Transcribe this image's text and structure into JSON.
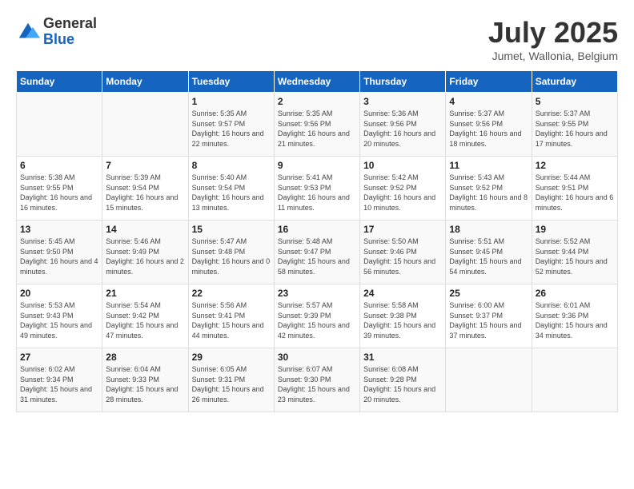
{
  "header": {
    "logo_general": "General",
    "logo_blue": "Blue",
    "month_year": "July 2025",
    "location": "Jumet, Wallonia, Belgium"
  },
  "days_of_week": [
    "Sunday",
    "Monday",
    "Tuesday",
    "Wednesday",
    "Thursday",
    "Friday",
    "Saturday"
  ],
  "weeks": [
    [
      {
        "day": "",
        "sunrise": "",
        "sunset": "",
        "daylight": ""
      },
      {
        "day": "",
        "sunrise": "",
        "sunset": "",
        "daylight": ""
      },
      {
        "day": "1",
        "sunrise": "Sunrise: 5:35 AM",
        "sunset": "Sunset: 9:57 PM",
        "daylight": "Daylight: 16 hours and 22 minutes."
      },
      {
        "day": "2",
        "sunrise": "Sunrise: 5:35 AM",
        "sunset": "Sunset: 9:56 PM",
        "daylight": "Daylight: 16 hours and 21 minutes."
      },
      {
        "day": "3",
        "sunrise": "Sunrise: 5:36 AM",
        "sunset": "Sunset: 9:56 PM",
        "daylight": "Daylight: 16 hours and 20 minutes."
      },
      {
        "day": "4",
        "sunrise": "Sunrise: 5:37 AM",
        "sunset": "Sunset: 9:56 PM",
        "daylight": "Daylight: 16 hours and 18 minutes."
      },
      {
        "day": "5",
        "sunrise": "Sunrise: 5:37 AM",
        "sunset": "Sunset: 9:55 PM",
        "daylight": "Daylight: 16 hours and 17 minutes."
      }
    ],
    [
      {
        "day": "6",
        "sunrise": "Sunrise: 5:38 AM",
        "sunset": "Sunset: 9:55 PM",
        "daylight": "Daylight: 16 hours and 16 minutes."
      },
      {
        "day": "7",
        "sunrise": "Sunrise: 5:39 AM",
        "sunset": "Sunset: 9:54 PM",
        "daylight": "Daylight: 16 hours and 15 minutes."
      },
      {
        "day": "8",
        "sunrise": "Sunrise: 5:40 AM",
        "sunset": "Sunset: 9:54 PM",
        "daylight": "Daylight: 16 hours and 13 minutes."
      },
      {
        "day": "9",
        "sunrise": "Sunrise: 5:41 AM",
        "sunset": "Sunset: 9:53 PM",
        "daylight": "Daylight: 16 hours and 11 minutes."
      },
      {
        "day": "10",
        "sunrise": "Sunrise: 5:42 AM",
        "sunset": "Sunset: 9:52 PM",
        "daylight": "Daylight: 16 hours and 10 minutes."
      },
      {
        "day": "11",
        "sunrise": "Sunrise: 5:43 AM",
        "sunset": "Sunset: 9:52 PM",
        "daylight": "Daylight: 16 hours and 8 minutes."
      },
      {
        "day": "12",
        "sunrise": "Sunrise: 5:44 AM",
        "sunset": "Sunset: 9:51 PM",
        "daylight": "Daylight: 16 hours and 6 minutes."
      }
    ],
    [
      {
        "day": "13",
        "sunrise": "Sunrise: 5:45 AM",
        "sunset": "Sunset: 9:50 PM",
        "daylight": "Daylight: 16 hours and 4 minutes."
      },
      {
        "day": "14",
        "sunrise": "Sunrise: 5:46 AM",
        "sunset": "Sunset: 9:49 PM",
        "daylight": "Daylight: 16 hours and 2 minutes."
      },
      {
        "day": "15",
        "sunrise": "Sunrise: 5:47 AM",
        "sunset": "Sunset: 9:48 PM",
        "daylight": "Daylight: 16 hours and 0 minutes."
      },
      {
        "day": "16",
        "sunrise": "Sunrise: 5:48 AM",
        "sunset": "Sunset: 9:47 PM",
        "daylight": "Daylight: 15 hours and 58 minutes."
      },
      {
        "day": "17",
        "sunrise": "Sunrise: 5:50 AM",
        "sunset": "Sunset: 9:46 PM",
        "daylight": "Daylight: 15 hours and 56 minutes."
      },
      {
        "day": "18",
        "sunrise": "Sunrise: 5:51 AM",
        "sunset": "Sunset: 9:45 PM",
        "daylight": "Daylight: 15 hours and 54 minutes."
      },
      {
        "day": "19",
        "sunrise": "Sunrise: 5:52 AM",
        "sunset": "Sunset: 9:44 PM",
        "daylight": "Daylight: 15 hours and 52 minutes."
      }
    ],
    [
      {
        "day": "20",
        "sunrise": "Sunrise: 5:53 AM",
        "sunset": "Sunset: 9:43 PM",
        "daylight": "Daylight: 15 hours and 49 minutes."
      },
      {
        "day": "21",
        "sunrise": "Sunrise: 5:54 AM",
        "sunset": "Sunset: 9:42 PM",
        "daylight": "Daylight: 15 hours and 47 minutes."
      },
      {
        "day": "22",
        "sunrise": "Sunrise: 5:56 AM",
        "sunset": "Sunset: 9:41 PM",
        "daylight": "Daylight: 15 hours and 44 minutes."
      },
      {
        "day": "23",
        "sunrise": "Sunrise: 5:57 AM",
        "sunset": "Sunset: 9:39 PM",
        "daylight": "Daylight: 15 hours and 42 minutes."
      },
      {
        "day": "24",
        "sunrise": "Sunrise: 5:58 AM",
        "sunset": "Sunset: 9:38 PM",
        "daylight": "Daylight: 15 hours and 39 minutes."
      },
      {
        "day": "25",
        "sunrise": "Sunrise: 6:00 AM",
        "sunset": "Sunset: 9:37 PM",
        "daylight": "Daylight: 15 hours and 37 minutes."
      },
      {
        "day": "26",
        "sunrise": "Sunrise: 6:01 AM",
        "sunset": "Sunset: 9:36 PM",
        "daylight": "Daylight: 15 hours and 34 minutes."
      }
    ],
    [
      {
        "day": "27",
        "sunrise": "Sunrise: 6:02 AM",
        "sunset": "Sunset: 9:34 PM",
        "daylight": "Daylight: 15 hours and 31 minutes."
      },
      {
        "day": "28",
        "sunrise": "Sunrise: 6:04 AM",
        "sunset": "Sunset: 9:33 PM",
        "daylight": "Daylight: 15 hours and 28 minutes."
      },
      {
        "day": "29",
        "sunrise": "Sunrise: 6:05 AM",
        "sunset": "Sunset: 9:31 PM",
        "daylight": "Daylight: 15 hours and 26 minutes."
      },
      {
        "day": "30",
        "sunrise": "Sunrise: 6:07 AM",
        "sunset": "Sunset: 9:30 PM",
        "daylight": "Daylight: 15 hours and 23 minutes."
      },
      {
        "day": "31",
        "sunrise": "Sunrise: 6:08 AM",
        "sunset": "Sunset: 9:28 PM",
        "daylight": "Daylight: 15 hours and 20 minutes."
      },
      {
        "day": "",
        "sunrise": "",
        "sunset": "",
        "daylight": ""
      },
      {
        "day": "",
        "sunrise": "",
        "sunset": "",
        "daylight": ""
      }
    ]
  ]
}
